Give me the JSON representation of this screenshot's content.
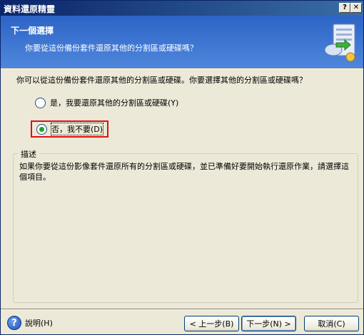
{
  "window": {
    "title": "資料還原精靈",
    "help_glyph": "?",
    "close_glyph": "✕"
  },
  "header": {
    "title": "下一個選擇",
    "subtitle": "你要從這份備份套件還原其他的分割區或硬碟嗎？"
  },
  "main": {
    "question": "你可以從這份備份套件還原其他的分割區或硬碟。你要選擇其他的分割區或硬碟嗎？",
    "options": [
      {
        "label": "是，我要還原其他的分割區或硬碟(Y)",
        "selected": false
      },
      {
        "label": "否，我不要(D)",
        "selected": true
      }
    ]
  },
  "description": {
    "caption": "描述",
    "text": "如果你要從這份影像套件還原所有的分割區或硬碟，並已準備好要開始執行還原作業，請選擇這個項目。"
  },
  "footer": {
    "help_glyph": "?",
    "help_label": "說明(H)",
    "back_label": "< 上一步(B)",
    "next_label": "下一步(N) >",
    "cancel_label": "取消(C)"
  },
  "colors": {
    "header_blue": "#2c64c6",
    "highlight_border": "#e01010",
    "radio_check": "#21a121"
  }
}
